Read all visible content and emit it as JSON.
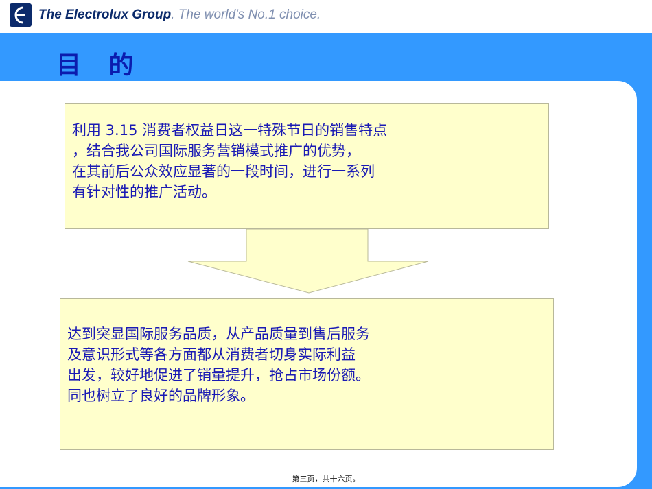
{
  "header": {
    "logo_icon": "electrolux-logo-icon",
    "brand_strong": "The Electrolux Group",
    "brand_tagline": ". The world's No.1 choice.",
    "brand_color": "#0b2a6b"
  },
  "slide": {
    "title": "目 的",
    "accent_color": "#3399ff",
    "box1_lines": [
      "利用 3.15 消费者权益日这一特殊节日的销售特点",
      "，结合我公司国际服务营销模式推广的优势，",
      "在其前后公众效应显著的一段时间，进行一系列",
      "有针对性的推广活动。"
    ],
    "box2_lines": [
      "达到突显国际服务品质，从产品质量到售后服务",
      "及意识形式等各方面都从消费者切身实际利益",
      "出发，较好地促进了销量提升，抢占市场份额。",
      "同也树立了良好的品牌形象。"
    ],
    "arrow_icon": "down-arrow-icon"
  },
  "footer": {
    "page_indicator": "第三页，共十六页。"
  }
}
